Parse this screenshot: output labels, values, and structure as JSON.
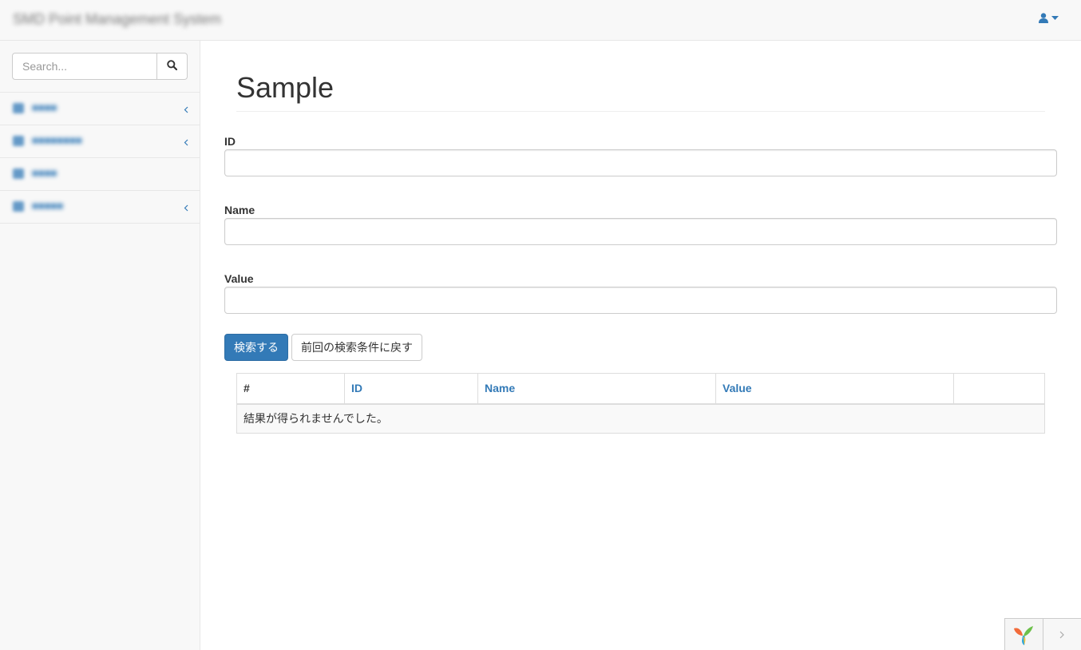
{
  "navbar": {
    "brand": "SMD Point Management System",
    "user_icon": "user-icon",
    "caret_icon": "caret-down-icon"
  },
  "sidebar": {
    "search_placeholder": "Search...",
    "search_icon": "search-icon",
    "items": [
      {
        "label": "■■■■",
        "icon": "dashboard-icon",
        "has_children": true
      },
      {
        "label": "■■■■■■■■",
        "icon": "file-icon",
        "has_children": true
      },
      {
        "label": "■■■■",
        "icon": "table-icon",
        "has_children": false
      },
      {
        "label": "■■■■■",
        "icon": "gear-icon",
        "has_children": true
      }
    ]
  },
  "main": {
    "title": "Sample",
    "fields": [
      {
        "label": "ID",
        "value": ""
      },
      {
        "label": "Name",
        "value": ""
      },
      {
        "label": "Value",
        "value": ""
      }
    ],
    "search_button": "検索する",
    "restore_button": "前回の検索条件に戻す",
    "table": {
      "columns": [
        "#",
        "ID",
        "Name",
        "Value",
        ""
      ],
      "empty_message": "結果が得られませんでした。"
    }
  },
  "colors": {
    "primary": "#337ab7",
    "navbar_bg": "#f8f8f8",
    "border": "#dddddd"
  }
}
